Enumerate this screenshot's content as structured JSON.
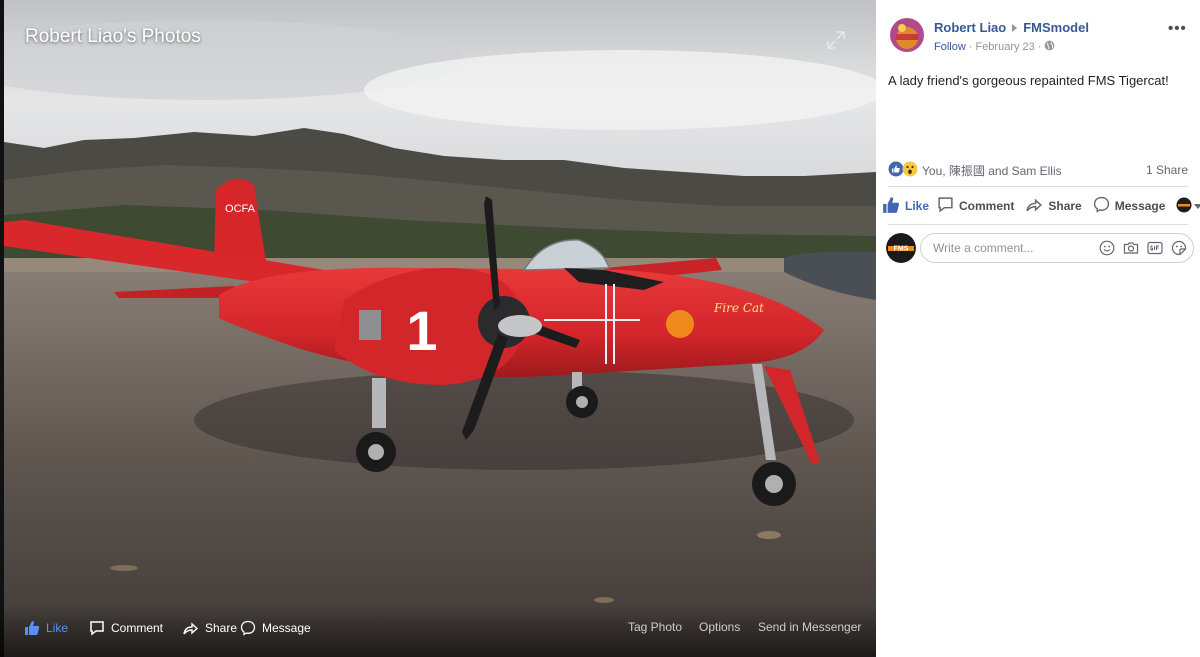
{
  "photo": {
    "album_title": "Robert Liao's Photos",
    "actions": {
      "like": "Like",
      "comment": "Comment",
      "share": "Share",
      "message": "Message",
      "tag_photo": "Tag Photo",
      "options": "Options",
      "send_in_messenger": "Send in Messenger"
    },
    "aircraft_markings": {
      "tail": "OCFA",
      "number": "1",
      "nose_art": "Fire Cat"
    }
  },
  "post": {
    "author": "Robert Liao",
    "group": "FMSmodel",
    "follow": "Follow",
    "date_prefix": "·",
    "date": "February 23",
    "date_suffix": "·",
    "more": "•••",
    "caption": "A lady friend's gorgeous repainted FMS Tigercat!",
    "reactions_text": "You, 陳振國 and Sam Ellis",
    "shares_text": "1 Share",
    "actions": {
      "like": "Like",
      "comment": "Comment",
      "share": "Share",
      "message": "Message"
    },
    "comment_placeholder": "Write a comment...",
    "commenter_avatar_text": "FMS"
  },
  "colors": {
    "link_blue": "#385898",
    "like_blue": "#4267b2",
    "text_dark": "#1d2129",
    "text_gray": "#90949c",
    "plane_red": "#d8262a"
  },
  "icons": [
    "expand-icon",
    "thumbs-up-icon",
    "comment-icon",
    "share-icon",
    "messenger-icon",
    "globe-icon",
    "like-reaction-icon",
    "wow-reaction-icon",
    "smiley-icon",
    "camera-icon",
    "gif-icon",
    "sticker-icon",
    "dropdown-arrow-icon"
  ]
}
